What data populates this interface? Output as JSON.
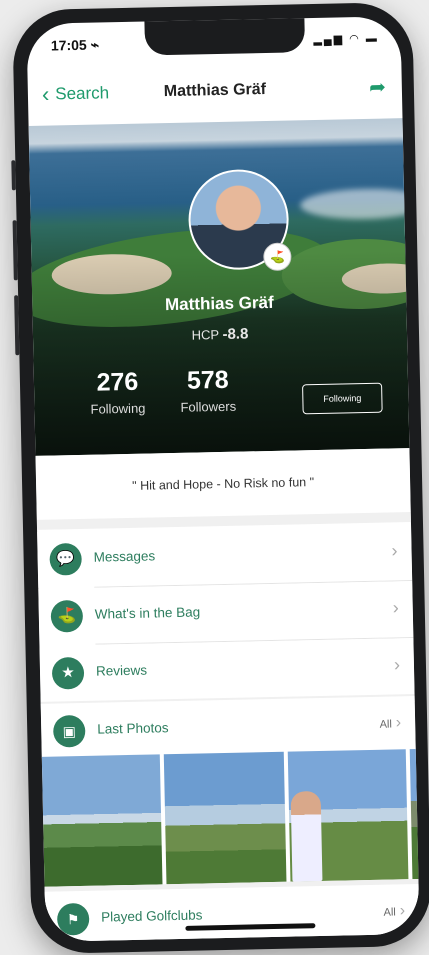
{
  "status": {
    "time": "17:05 ⌁",
    "icons": "▂▄▆ ◠ ▬"
  },
  "nav": {
    "back_label": "Search",
    "title": "Matthias Gräf"
  },
  "profile": {
    "name": "Matthias Gräf",
    "hcp_label": "HCP",
    "hcp_value": "-8.8",
    "following_count": "276",
    "following_label": "Following",
    "followers_count": "578",
    "followers_label": "Followers",
    "follow_button": "Following",
    "quote": "\" Hit and Hope - No Risk no fun \""
  },
  "menu": {
    "messages": "Messages",
    "bag": "What's in the Bag",
    "reviews": "Reviews"
  },
  "sections": {
    "photos_title": "Last Photos",
    "photos_all": "All",
    "clubs_title": "Played Golfclubs",
    "clubs_all": "All"
  },
  "icons": {
    "back": "chevron-left-icon",
    "share": "share-arrow-icon",
    "messages": "chat-bubble-icon",
    "bag": "golf-bag-icon",
    "reviews": "star-icon",
    "photos": "image-icon",
    "clubs": "flag-icon"
  },
  "colors": {
    "accent": "#2d7d5e",
    "link": "#1f9a6c"
  }
}
